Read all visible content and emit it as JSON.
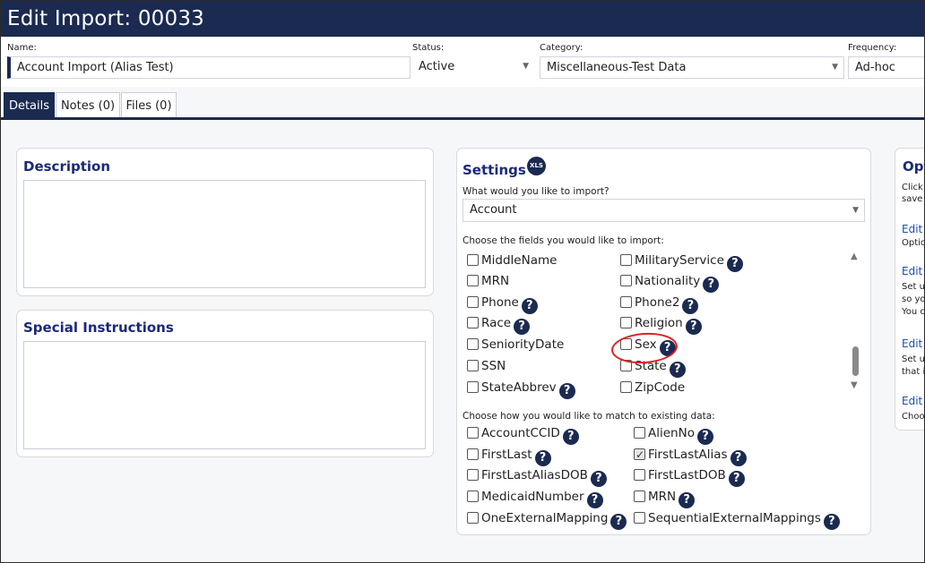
{
  "title": "Edit Import: 00033",
  "fields": {
    "name_label": "Name:",
    "name_value": "Account Import (Alias Test)",
    "status_label": "Status:",
    "status_value": "Active",
    "category_label": "Category:",
    "category_value": "Miscellaneous-Test Data",
    "frequency_label": "Frequency:",
    "frequency_value": "Ad-hoc"
  },
  "tabs": [
    "Details",
    "Notes (0)",
    "Files (0)"
  ],
  "description": {
    "title": "Description"
  },
  "special_instructions": {
    "title": "Special Instructions"
  },
  "settings": {
    "title": "Settings",
    "xls_badge": "XLS",
    "import_label": "What would you like to import?",
    "import_value": "Account",
    "fields_label": "Choose the fields you would like to import:",
    "fields": [
      {
        "label": "MiddleName",
        "help": false,
        "checked": false
      },
      {
        "label": "MilitaryService",
        "help": true,
        "checked": false
      },
      {
        "label": "MRN",
        "help": false,
        "checked": false
      },
      {
        "label": "Nationality",
        "help": true,
        "checked": false
      },
      {
        "label": "Phone",
        "help": true,
        "checked": false
      },
      {
        "label": "Phone2",
        "help": true,
        "checked": false
      },
      {
        "label": "Race",
        "help": true,
        "checked": false
      },
      {
        "label": "Religion",
        "help": true,
        "checked": false
      },
      {
        "label": "SeniorityDate",
        "help": false,
        "checked": false
      },
      {
        "label": "Sex",
        "help": true,
        "checked": false
      },
      {
        "label": "SSN",
        "help": false,
        "checked": false
      },
      {
        "label": "State",
        "help": true,
        "checked": false
      },
      {
        "label": "StateAbbrev",
        "help": true,
        "checked": false
      },
      {
        "label": "ZipCode",
        "help": false,
        "checked": false
      }
    ],
    "match_label": "Choose how you would like to match to existing data:",
    "match": [
      {
        "label": "AccountCCID",
        "help": true,
        "checked": false
      },
      {
        "label": "AlienNo",
        "help": true,
        "checked": false
      },
      {
        "label": "FirstLast",
        "help": true,
        "checked": false
      },
      {
        "label": "FirstLastAlias",
        "help": true,
        "checked": true
      },
      {
        "label": "FirstLastAliasDOB",
        "help": true,
        "checked": false
      },
      {
        "label": "FirstLastDOB",
        "help": true,
        "checked": false
      },
      {
        "label": "MedicaidNumber",
        "help": true,
        "checked": false
      },
      {
        "label": "MRN",
        "help": true,
        "checked": false
      },
      {
        "label": "OneExternalMapping",
        "help": true,
        "checked": false
      },
      {
        "label": "SequentialExternalMappings",
        "help": true,
        "checked": false
      }
    ]
  },
  "options": {
    "title": "Opt",
    "intro_1": "Click",
    "intro_2": "save",
    "link1": "Edit",
    "text1": "Optio",
    "link2": "Edit",
    "text2a": "Set u",
    "text2b": "so yo",
    "text2c": "You c",
    "link3": "Edit",
    "text3a": "Set u",
    "text3b": "that i",
    "link4": "Edit",
    "text4": "Choo"
  },
  "colors": {
    "navy": "#1b2a50",
    "accent_title": "#1b2a78",
    "annotation": "#e02020"
  },
  "icons": {
    "help": "question-circle-icon",
    "dropdown": "chevron-down-icon"
  }
}
